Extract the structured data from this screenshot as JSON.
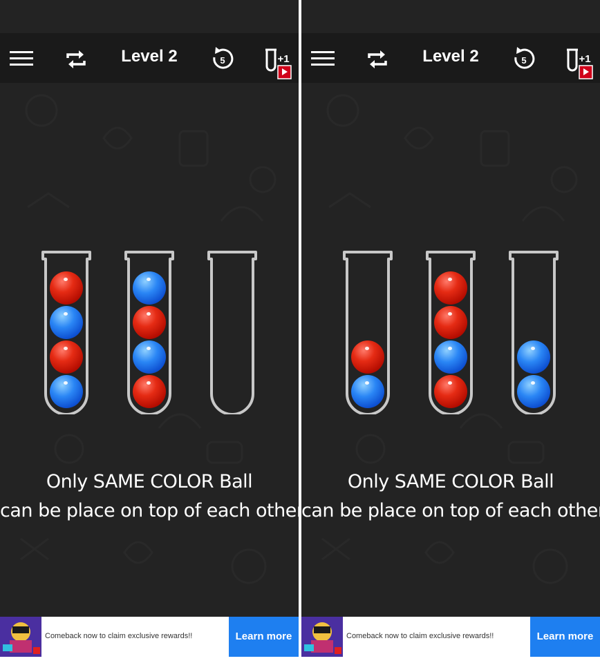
{
  "screens": [
    {
      "title": "Level 2",
      "undo_count": "5",
      "add_tube_label": "+1",
      "message_line1": "Only SAME COLOR Ball",
      "message_line2": "can be place on top of each other",
      "tubes": [
        [
          "red",
          "blue",
          "red",
          "blue"
        ],
        [
          "blue",
          "red",
          "blue",
          "red"
        ],
        []
      ],
      "ad": {
        "text": "Comeback now to claim exclusive rewards!!",
        "button": "Learn more"
      }
    },
    {
      "title": "Level 2",
      "undo_count": "5",
      "add_tube_label": "+1",
      "message_line1": "Only SAME COLOR Ball",
      "message_line2": "can be place on top of each other",
      "tubes": [
        [
          "red",
          "blue"
        ],
        [
          "red",
          "red",
          "blue",
          "red"
        ],
        [
          "blue",
          "blue"
        ]
      ],
      "ad": {
        "text": "Comeback now to claim exclusive rewards!!",
        "button": "Learn more"
      }
    }
  ],
  "icons": {
    "menu": "hamburger-menu-icon",
    "restart": "repeat-arrows-icon",
    "undo": "undo-circle-icon",
    "add_tube": "test-tube-plus-icon",
    "video": "play-video-icon"
  },
  "colors": {
    "background": "#232323",
    "red_ball": "#e52b14",
    "blue_ball": "#2a86f5",
    "tube_outline": "#c8c8c8",
    "ad_button": "#1e7ff0",
    "video_badge": "#d0021b"
  }
}
